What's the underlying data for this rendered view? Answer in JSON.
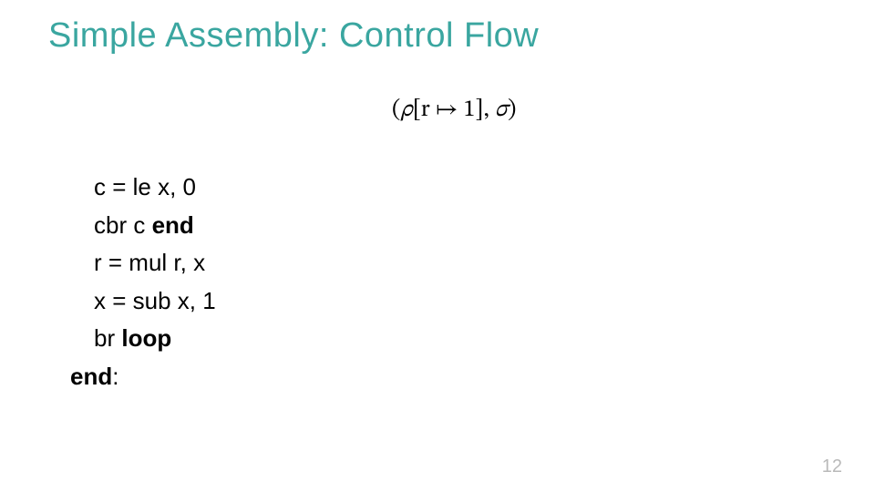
{
  "title": "Simple Assembly: Control Flow",
  "formula": {
    "open": "(",
    "rho": "ρ",
    "lbracket": "[",
    "r": "r",
    "mapsto": " ↦ ",
    "one": "1",
    "rbracket": "]",
    "comma": ", ",
    "sigma": "σ",
    "close": ")"
  },
  "code": {
    "l1_pre": "c = le x, 0",
    "l2_pre": "cbr c ",
    "l2_bold": "end",
    "l3_pre": "r = mul r, x",
    "l4_pre": "x = sub x, 1",
    "l5_pre": "br ",
    "l5_bold": "loop",
    "l6_bold": "end",
    "l6_post": ":"
  },
  "page_number": "12"
}
